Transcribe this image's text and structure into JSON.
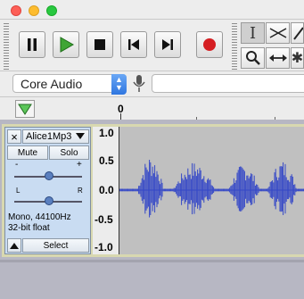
{
  "window": {
    "traffic_lights": {
      "close": "#fd5f57",
      "minimize": "#fdbc2e",
      "maximize": "#28c840"
    }
  },
  "device": {
    "host": "Core Audio"
  },
  "timeline": {
    "tick_label": "0"
  },
  "track": {
    "name": "Alice1Mp3",
    "mute_label": "Mute",
    "solo_label": "Solo",
    "gain_min": "-",
    "gain_max": "+",
    "pan_left": "L",
    "pan_right": "R",
    "format_line1": "Mono, 44100Hz",
    "format_line2": "32-bit float",
    "select_label": "Select",
    "close_glyph": "×",
    "scale": [
      "1.0",
      "0.5",
      "0.0",
      "-0.5",
      "-1.0"
    ],
    "waveform_color": "#3447c7",
    "selection_border_color": "#d9ec3a"
  }
}
